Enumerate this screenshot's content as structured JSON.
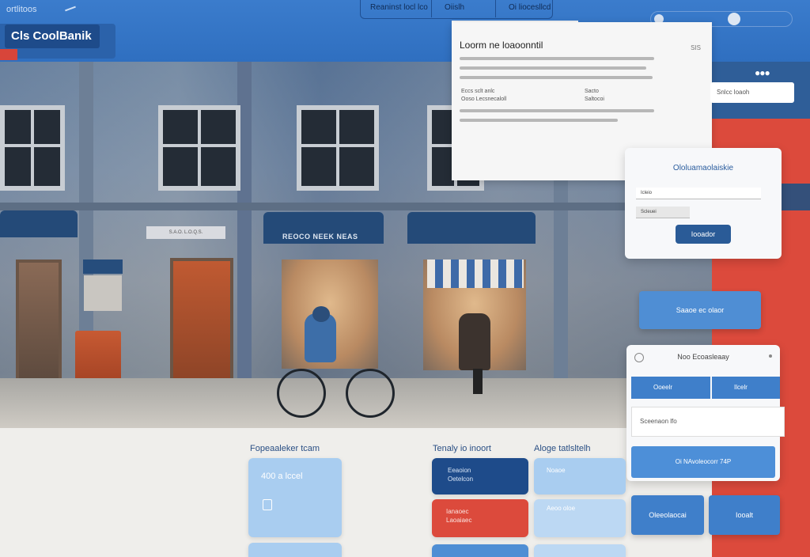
{
  "header": {
    "app_title": "ortlitoos",
    "nav": [
      "Reaninst locl lco",
      "Oiislh",
      "Oi liocesllcd"
    ],
    "brand": "Cls CoolBanik",
    "search_placeholder": ""
  },
  "doc_panel": {
    "title": "Loorm ne loaoonntil",
    "size_label": "SIS",
    "row1_left": "Eccs sclt anlc",
    "row1_right": "Sacto",
    "row2_left": "Ooso Lecsnecaloll",
    "row2_right": "Saltocoi"
  },
  "side_field": {
    "label": "Snlcc loaoh"
  },
  "painting": {
    "shop_sign": "REOCO NEEK NEAS",
    "left_sign": "S.A.O. L.O.Q.S."
  },
  "login": {
    "title": "Ololuamaolaiskie",
    "field1": "Icleio",
    "field2": "Scleuei",
    "button": "Iooador"
  },
  "cta_button": {
    "label": "Saaoe ec olaor"
  },
  "panel2": {
    "title": "Noo Ecoasleaay",
    "seg_left": "Ooeelr",
    "seg_right": "Ilcelr",
    "field": "Sceenaon lfo",
    "button": "Oi NAvoleocorr 74P"
  },
  "sections": {
    "s1": "Fopeaaleker tcam",
    "s2": "Tenaly io inoort",
    "s3": "Aloge tatlsltelh"
  },
  "tiles": {
    "t1_text": "400 a lccel",
    "t2_text": "Eeaoion Oetelcon",
    "t3_text": "Ianaoec Laoaiaec",
    "t4_text": "Noaoe",
    "t5_text": "Aeoo oloe"
  },
  "bottom_buttons": {
    "b1": "Oleeolaocai",
    "b2": "Iooalt"
  },
  "colors": {
    "topbar": "#2f6fc0",
    "accent_red": "#dc4a3c",
    "navy": "#1e4b8a",
    "light_blue": "#a9cdf0"
  }
}
